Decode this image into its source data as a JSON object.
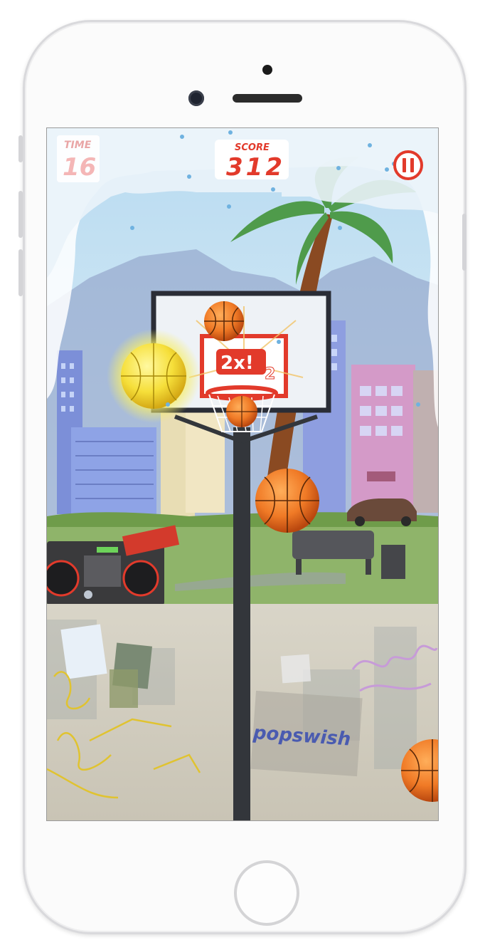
{
  "hud": {
    "time_label": "TIME",
    "time_value": "16",
    "score_label": "SCORE",
    "score_value": "312"
  },
  "multiplier_badge": "2x!",
  "multiplier_sub": "2",
  "wall_logo": "popswish",
  "colors": {
    "accent_red": "#e23a2b",
    "ball_orange": "#f07a26",
    "ball_glow": "#f9e43a"
  },
  "icons": {
    "pause": "pause-icon",
    "home": "home-button"
  }
}
